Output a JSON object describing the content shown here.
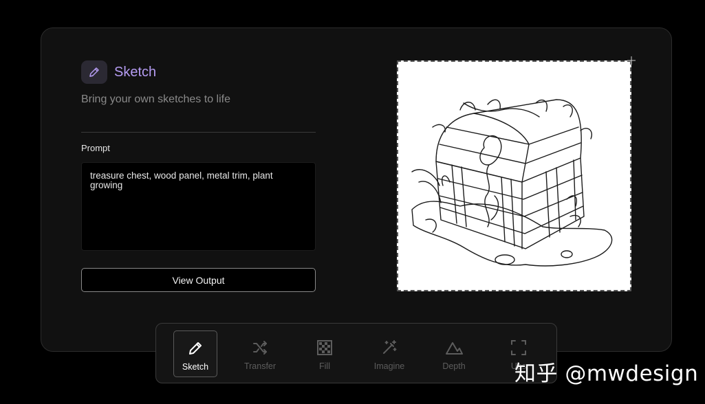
{
  "header": {
    "icon": "pencil-icon",
    "title": "Sketch",
    "subtitle": "Bring your own sketches to life"
  },
  "prompt": {
    "label": "Prompt",
    "value": "treasure chest, wood panel, metal trim, plant growing"
  },
  "actions": {
    "view_output_label": "View Output"
  },
  "canvas": {
    "content": "sketch-image"
  },
  "toolbar": {
    "tools": [
      {
        "label": "Sketch",
        "icon": "pencil-icon",
        "active": true
      },
      {
        "label": "Transfer",
        "icon": "shuffle-icon",
        "active": false
      },
      {
        "label": "Fill",
        "icon": "checkerboard-icon",
        "active": false
      },
      {
        "label": "Imagine",
        "icon": "magic-wand-icon",
        "active": false
      },
      {
        "label": "Depth",
        "icon": "mountain-icon",
        "active": false
      },
      {
        "label": "Ups",
        "icon": "expand-icon",
        "active": false
      }
    ]
  },
  "watermark": {
    "text": "知乎 @mwdesign"
  },
  "colors": {
    "accent": "#b59cf2",
    "panel_bg": "#111111",
    "page_bg": "#000000",
    "muted_text": "#8a8a8a"
  }
}
